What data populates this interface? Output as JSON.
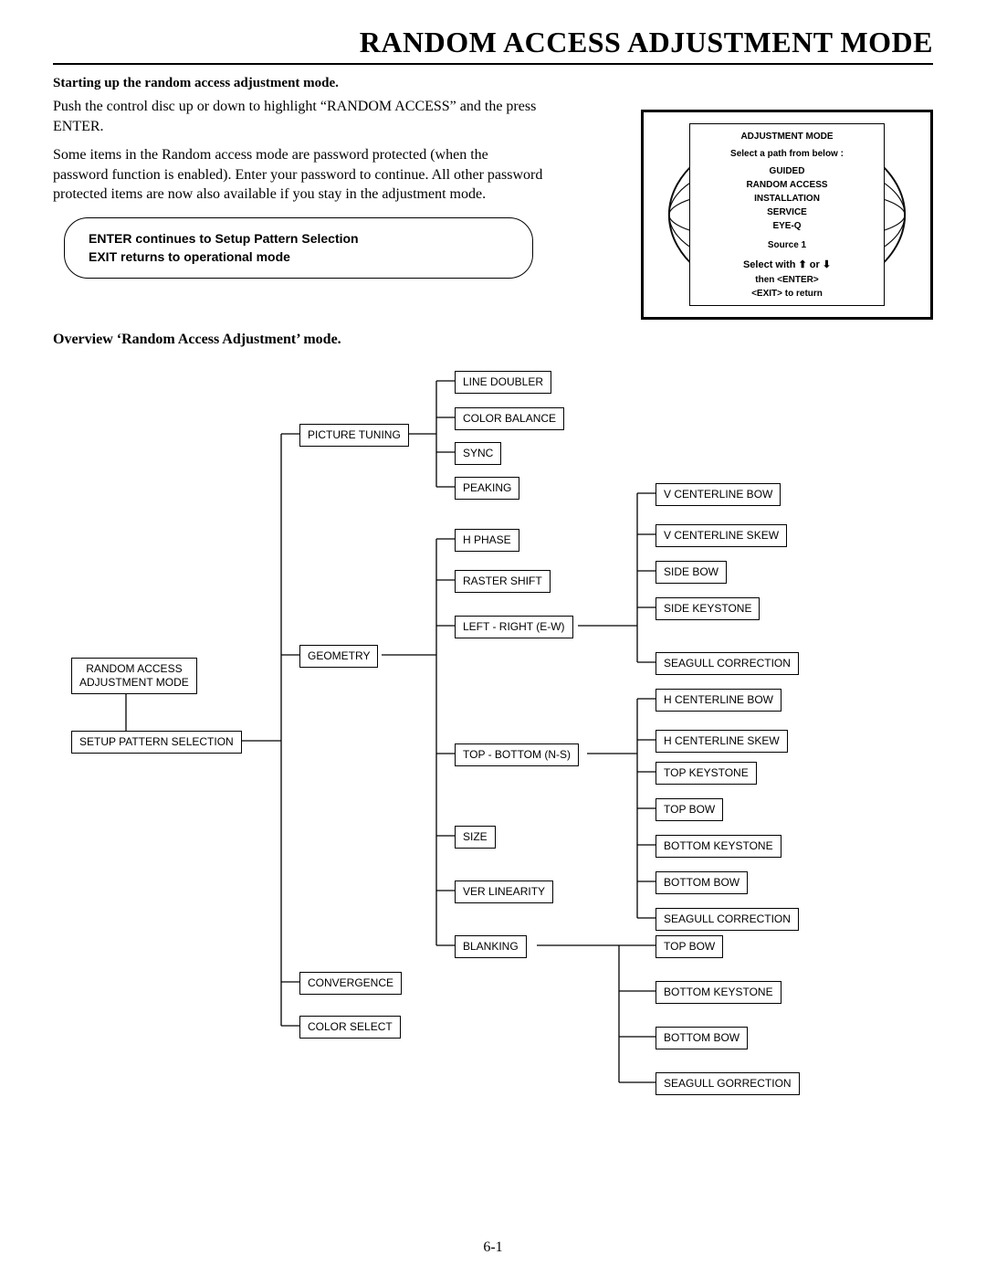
{
  "title": "RANDOM ACCESS ADJUSTMENT MODE",
  "heading1": "Starting up the random access adjustment mode.",
  "para1": "Push the control disc up or down to highlight “RANDOM ACCESS” and the press ENTER.",
  "para2": "Some items in the Random access mode are password protected (when the password function is enabled). Enter your password to continue. All other password protected items are now also available if you stay in the adjustment mode.",
  "callout": {
    "line1": "ENTER continues to Setup Pattern Selection",
    "line2": "EXIT returns to operational mode"
  },
  "heading2": "Overview ‘Random Access Adjustment’ mode.",
  "panel": {
    "title": "ADJUSTMENT MODE",
    "prompt": "Select a path from below :",
    "items": [
      "GUIDED",
      "RANDOM ACCESS",
      "INSTALLATION",
      "SERVICE",
      "EYE-Q"
    ],
    "source": "Source  1",
    "hint1": "Select with ⬆ or ⬇",
    "hint2": "then <ENTER>",
    "hint3": "<EXIT> to return"
  },
  "page_number": "6-1",
  "chart_data": {
    "type": "tree",
    "root": "RANDOM ACCESS ADJUSTMENT MODE",
    "nodes": {
      "RANDOM ACCESS ADJUSTMENT MODE": [
        "SETUP PATTERN SELECTION"
      ],
      "SETUP PATTERN SELECTION": [
        "PICTURE TUNING",
        "GEOMETRY",
        "CONVERGENCE",
        "COLOR SELECT"
      ],
      "PICTURE TUNING": [
        "LINE DOUBLER",
        "COLOR BALANCE",
        "SYNC",
        "PEAKING"
      ],
      "GEOMETRY": [
        "H PHASE",
        "RASTER SHIFT",
        "LEFT - RIGHT (E-W)",
        "TOP - BOTTOM (N-S)",
        "SIZE",
        "VER LINEARITY",
        "BLANKING"
      ],
      "LEFT - RIGHT (E-W)": [
        "V CENTERLINE BOW",
        "V CENTERLINE SKEW",
        "SIDE BOW",
        "SIDE KEYSTONE",
        "SEAGULL CORRECTION"
      ],
      "TOP - BOTTOM (N-S)": [
        "H CENTERLINE BOW",
        "H CENTERLINE SKEW",
        "TOP KEYSTONE",
        "TOP BOW",
        "BOTTOM KEYSTONE",
        "BOTTOM BOW",
        "SEAGULL CORRECTION"
      ],
      "BLANKING": [
        "TOP BOW",
        "BOTTOM KEYSTONE",
        "BOTTOM BOW",
        "SEAGULL GORRECTION"
      ]
    }
  },
  "labels": {
    "root1": "RANDOM ACCESS",
    "root2": "ADJUSTMENT MODE",
    "setup": "SETUP PATTERN SELECTION",
    "picture": "PICTURE TUNING",
    "geometry": "GEOMETRY",
    "convergence": "CONVERGENCE",
    "colorselect": "COLOR SELECT",
    "line_doubler": "LINE DOUBLER",
    "color_balance": "COLOR BALANCE",
    "sync": "SYNC",
    "peaking": "PEAKING",
    "hphase": "H PHASE",
    "raster": "RASTER SHIFT",
    "lrew": "LEFT - RIGHT (E-W)",
    "tbns": "TOP - BOTTOM (N-S)",
    "size": "SIZE",
    "vlin": "VER LINEARITY",
    "blank": "BLANKING",
    "vcb": "V CENTERLINE BOW",
    "vcs": "V CENTERLINE SKEW",
    "sbow": "SIDE BOW",
    "skey": "SIDE KEYSTONE",
    "seagull": "SEAGULL CORRECTION",
    "hcb": "H CENTERLINE BOW",
    "hcs": "H CENTERLINE SKEW",
    "tkey": "TOP KEYSTONE",
    "tbow": "TOP BOW",
    "bkey": "BOTTOM KEYSTONE",
    "bbow": "BOTTOM BOW",
    "seagull2": "SEAGULL CORRECTION",
    "tbow2": "TOP BOW",
    "bkey2": "BOTTOM KEYSTONE",
    "bbow2": "BOTTOM BOW",
    "seagull3": "SEAGULL GORRECTION"
  }
}
